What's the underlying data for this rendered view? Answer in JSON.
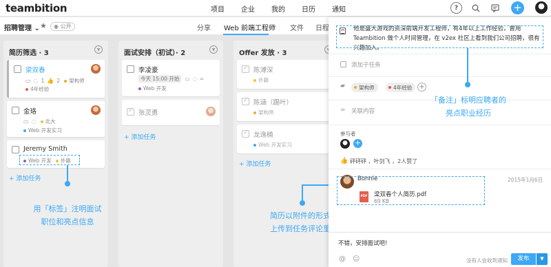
{
  "app": {
    "logo": "teambition"
  },
  "topnav": [
    "项目",
    "企业",
    "我的",
    "日历",
    "通知"
  ],
  "topbar_icons": [
    "help-icon",
    "search-icon",
    "chat-icon",
    "add-icon"
  ],
  "project": {
    "name": "招聘管理",
    "badge": "公开",
    "tabs": [
      "分享",
      "Web 前端工程师",
      "文件",
      "日程"
    ]
  },
  "columns": [
    {
      "title": "简历筛选 · 3",
      "cards": [
        {
          "title": "梁双春",
          "comments": "1",
          "likes": "2",
          "tag": "架构师",
          "tag2": "4年经验"
        },
        {
          "title": "金珞",
          "tag": "北大",
          "tag2": "Web 开发实习"
        },
        {
          "title": "Jeremy Smith",
          "tag": "Web 开发",
          "tag2": "外籍"
        }
      ],
      "add": "添加任务"
    },
    {
      "title": "面试安排（初试）· 2",
      "cards": [
        {
          "title": "李凌豪",
          "date": "今天 15:00 开始",
          "tag": "Web 开发"
        },
        {
          "title": "张灵勇"
        }
      ],
      "add": "添加任务"
    },
    {
      "title": "Offer 发放 · 3",
      "cards": [
        {
          "title": "陈溥深",
          "tag": "外籍"
        },
        {
          "title": "陈涵（踢叶）",
          "tag": "架构师"
        },
        {
          "title": "龙逸楠",
          "tag": "Web 开发实习"
        }
      ],
      "add": "添加任务"
    }
  ],
  "annotations": {
    "tags": [
      "用「标签」注明面试",
      "职位和亮点信息"
    ],
    "attachment": [
      "简历以附件的形式",
      "上传到任务评论里"
    ],
    "note": [
      "「备注」标明应聘者的",
      "亮点职业经历"
    ]
  },
  "detail": {
    "description": "他是盛大游戏的资深前端开发工程师，有4年以上工作经验，曾用 Teambition 做个人时间管理，在 v2ex 社区上看到我们公司招聘，很有兴趣加入。",
    "subtask_placeholder": "添加子任务",
    "tags": [
      "架构师",
      "4年经验"
    ],
    "link_placeholder": "关联内容",
    "participants_label": "参与者",
    "likes": "砰砰砰 ，叶剑飞 ，2人赞了",
    "comment": {
      "author": "Bonnie",
      "date": "2015年1月6日",
      "file_name": "梁双春个人简历.pdf",
      "file_type": "PDF",
      "file_size": "69 KB"
    },
    "compose_text": "不错，安排面试吧!",
    "compose_hint": "没有人会收到通知",
    "send": "发布"
  },
  "colors": {
    "accent": "#3da8f5",
    "tag_orange": "#f5a623",
    "tag_red": "#e8574d",
    "tag_purple": "#9b59b6",
    "tag_yellow": "#f2c230"
  }
}
